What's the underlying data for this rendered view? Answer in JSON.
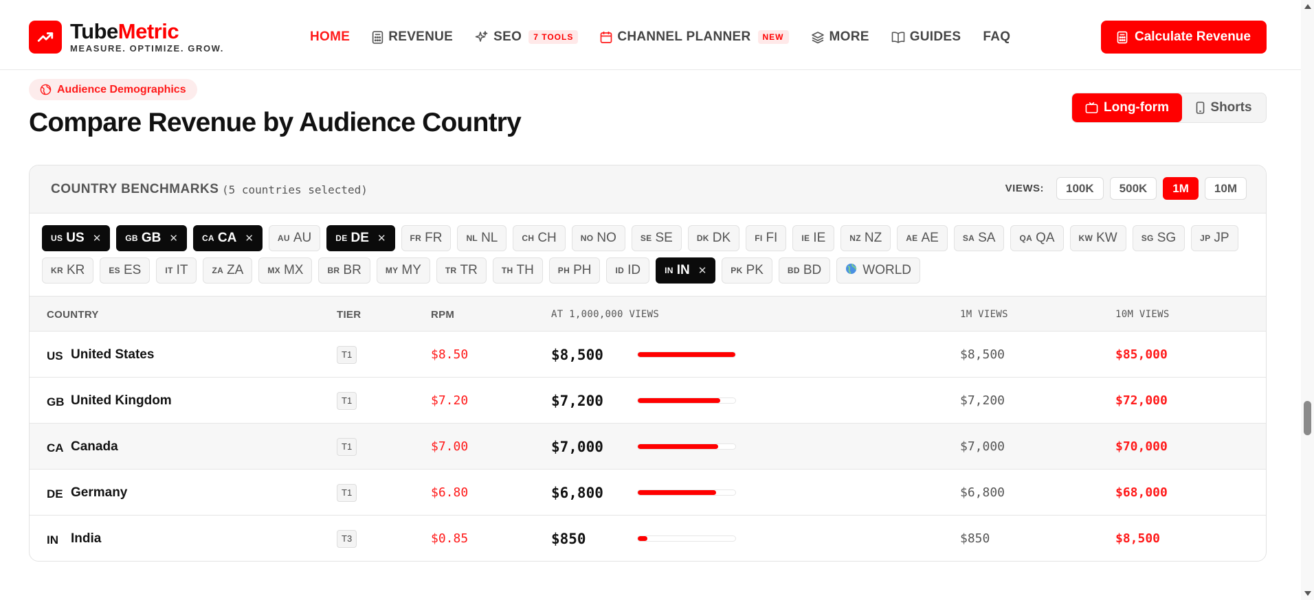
{
  "brand": {
    "name_part1": "Tube",
    "name_part2": "Metric",
    "tagline": "MEASURE. OPTIMIZE. GROW.",
    "accent": "#ff0000"
  },
  "nav": {
    "items": [
      {
        "label": "HOME",
        "icon": "",
        "active": true
      },
      {
        "label": "REVENUE",
        "icon": "calculator-icon"
      },
      {
        "label": "SEO",
        "icon": "sparkles-icon",
        "badge": "7 TOOLS"
      },
      {
        "label": "CHANNEL PLANNER",
        "icon": "calendar-icon",
        "badge": "NEW"
      },
      {
        "label": "MORE",
        "icon": "layers-icon"
      },
      {
        "label": "GUIDES",
        "icon": "book-icon"
      },
      {
        "label": "FAQ",
        "icon": ""
      }
    ],
    "cta_label": "Calculate Revenue"
  },
  "section": {
    "pill_label": "Audience Demographics",
    "title": "Compare Revenue by Audience Country",
    "format_toggle": {
      "longform": "Long-form",
      "shorts": "Shorts",
      "selected": "Long-form"
    }
  },
  "card": {
    "title": "COUNTRY BENCHMARKS",
    "subtitle": "(5 countries selected)",
    "views_label": "VIEWS:",
    "views_options": [
      "100K",
      "500K",
      "1M",
      "10M"
    ],
    "views_selected": "1M"
  },
  "chips": {
    "row1": [
      {
        "code": "US",
        "label": "US",
        "selected": true
      },
      {
        "code": "GB",
        "label": "GB",
        "selected": true
      },
      {
        "code": "CA",
        "label": "CA",
        "selected": true
      },
      {
        "code": "AU",
        "label": "AU",
        "selected": false
      },
      {
        "code": "DE",
        "label": "DE",
        "selected": true
      },
      {
        "code": "FR",
        "label": "FR",
        "selected": false
      },
      {
        "code": "NL",
        "label": "NL",
        "selected": false
      },
      {
        "code": "CH",
        "label": "CH",
        "selected": false
      },
      {
        "code": "NO",
        "label": "NO",
        "selected": false
      },
      {
        "code": "SE",
        "label": "SE",
        "selected": false
      },
      {
        "code": "DK",
        "label": "DK",
        "selected": false
      },
      {
        "code": "FI",
        "label": "FI",
        "selected": false
      },
      {
        "code": "IE",
        "label": "IE",
        "selected": false
      },
      {
        "code": "NZ",
        "label": "NZ",
        "selected": false
      },
      {
        "code": "AE",
        "label": "AE",
        "selected": false
      },
      {
        "code": "SA",
        "label": "SA",
        "selected": false
      },
      {
        "code": "QA",
        "label": "QA",
        "selected": false
      },
      {
        "code": "KW",
        "label": "KW",
        "selected": false
      },
      {
        "code": "SG",
        "label": "SG",
        "selected": false
      },
      {
        "code": "JP",
        "label": "JP",
        "selected": false
      }
    ],
    "row2": [
      {
        "code": "KR",
        "label": "KR",
        "selected": false
      },
      {
        "code": "ES",
        "label": "ES",
        "selected": false
      },
      {
        "code": "IT",
        "label": "IT",
        "selected": false
      },
      {
        "code": "ZA",
        "label": "ZA",
        "selected": false
      },
      {
        "code": "MX",
        "label": "MX",
        "selected": false
      },
      {
        "code": "BR",
        "label": "BR",
        "selected": false
      },
      {
        "code": "MY",
        "label": "MY",
        "selected": false
      },
      {
        "code": "TR",
        "label": "TR",
        "selected": false
      },
      {
        "code": "TH",
        "label": "TH",
        "selected": false
      },
      {
        "code": "PH",
        "label": "PH",
        "selected": false
      },
      {
        "code": "ID",
        "label": "ID",
        "selected": false
      },
      {
        "code": "IN",
        "label": "IN",
        "selected": true
      },
      {
        "code": "PK",
        "label": "PK",
        "selected": false
      },
      {
        "code": "BD",
        "label": "BD",
        "selected": false
      },
      {
        "code": "",
        "label": "WORLD",
        "selected": false,
        "icon": "globe-icon"
      }
    ]
  },
  "table": {
    "headers": {
      "country": "COUNTRY",
      "tier": "TIER",
      "rpm": "RPM",
      "at_views": "AT 1,000,000 VIEWS",
      "v1m": "1M VIEWS",
      "v10m": "10M VIEWS"
    },
    "rows": [
      {
        "code": "US",
        "country": "United States",
        "tier": "T1",
        "rpm": "$8.50",
        "amount": "$8,500",
        "bar_fraction": 1.0,
        "v1m": "$8,500",
        "v10m": "$85,000"
      },
      {
        "code": "GB",
        "country": "United Kingdom",
        "tier": "T1",
        "rpm": "$7.20",
        "amount": "$7,200",
        "bar_fraction": 0.847,
        "v1m": "$7,200",
        "v10m": "$72,000"
      },
      {
        "code": "CA",
        "country": "Canada",
        "tier": "T1",
        "rpm": "$7.00",
        "amount": "$7,000",
        "bar_fraction": 0.824,
        "v1m": "$7,000",
        "v10m": "$70,000"
      },
      {
        "code": "DE",
        "country": "Germany",
        "tier": "T1",
        "rpm": "$6.80",
        "amount": "$6,800",
        "bar_fraction": 0.8,
        "v1m": "$6,800",
        "v10m": "$68,000"
      },
      {
        "code": "IN",
        "country": "India",
        "tier": "T3",
        "rpm": "$0.85",
        "amount": "$850",
        "bar_fraction": 0.1,
        "v1m": "$850",
        "v10m": "$8,500"
      }
    ]
  }
}
